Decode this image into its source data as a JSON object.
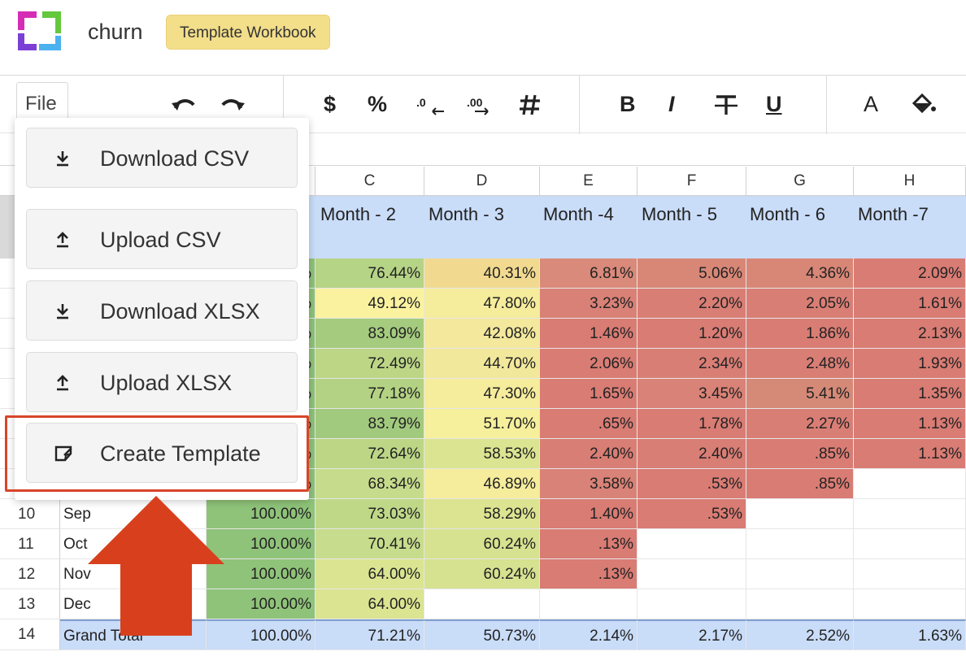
{
  "app": {
    "title": "churn",
    "badge": "Template Workbook"
  },
  "toolbar": {
    "file_label": "File",
    "currency": "$",
    "percent": "%",
    "bold": "B",
    "italic": "I",
    "underline": "U",
    "font_color": "A",
    "icons": [
      "undo-icon",
      "redo-icon",
      "currency-icon",
      "percent-icon",
      "decrease-decimal-icon",
      "increase-decimal-icon",
      "number-format-icon",
      "bold-icon",
      "italic-icon",
      "strikethrough-icon",
      "underline-icon",
      "font-color-icon",
      "fill-color-icon"
    ]
  },
  "menu": {
    "items": [
      {
        "label": "Download CSV",
        "icon": "download-icon"
      },
      {
        "label": "Upload CSV",
        "icon": "upload-icon"
      },
      {
        "label": "Download XLSX",
        "icon": "download-icon"
      },
      {
        "label": "Upload XLSX",
        "icon": "upload-icon"
      },
      {
        "label": "Create Template",
        "icon": "create-template-icon"
      }
    ],
    "highlight_color": "#d8452a"
  },
  "grid": {
    "columns": [
      "C",
      "D",
      "E",
      "F",
      "G",
      "H"
    ],
    "month_headers": [
      "Month - 2",
      "Month - 3",
      "Month -4",
      "Month - 5",
      "Month - 6",
      "Month -7"
    ],
    "partial_b_values": [
      "%",
      "%",
      "%",
      "%",
      "%",
      "%",
      "%",
      "%"
    ],
    "rows": [
      {
        "c": "76.44%",
        "d": "40.31%",
        "e": "6.81%",
        "f": "5.06%",
        "g": "4.36%",
        "h": "2.09%"
      },
      {
        "c": "49.12%",
        "d": "47.80%",
        "e": "3.23%",
        "f": "2.20%",
        "g": "2.05%",
        "h": "1.61%"
      },
      {
        "c": "83.09%",
        "d": "42.08%",
        "e": "1.46%",
        "f": "1.20%",
        "g": "1.86%",
        "h": "2.13%"
      },
      {
        "c": "72.49%",
        "d": "44.70%",
        "e": "2.06%",
        "f": "2.34%",
        "g": "2.48%",
        "h": "1.93%"
      },
      {
        "c": "77.18%",
        "d": "47.30%",
        "e": "1.65%",
        "f": "3.45%",
        "g": "5.41%",
        "h": "1.35%"
      },
      {
        "c": "83.79%",
        "d": "51.70%",
        "e": ".65%",
        "f": "1.78%",
        "g": "2.27%",
        "h": "1.13%"
      },
      {
        "c": "72.64%",
        "d": "58.53%",
        "e": "2.40%",
        "f": "2.40%",
        "g": ".85%",
        "h": "1.13%"
      },
      {
        "c": "68.34%",
        "d": "46.89%",
        "e": "3.58%",
        "f": ".53%",
        "g": ".85%",
        "h": ""
      }
    ],
    "lower_rows": [
      {
        "num": "10",
        "label": "Sep",
        "b": "100.00%",
        "c": "73.03%",
        "d": "58.29%",
        "e": "1.40%",
        "f": ".53%",
        "g": "",
        "h": ""
      },
      {
        "num": "11",
        "label": "Oct",
        "b": "100.00%",
        "c": "70.41%",
        "d": "60.24%",
        "e": ".13%",
        "f": "",
        "g": "",
        "h": ""
      },
      {
        "num": "12",
        "label": "Nov",
        "b": "100.00%",
        "c": "64.00%",
        "d": "60.24%",
        "e": ".13%",
        "f": "",
        "g": "",
        "h": ""
      },
      {
        "num": "13",
        "label": "Dec",
        "b": "100.00%",
        "c": "64.00%",
        "d": "",
        "e": "",
        "f": "",
        "g": "",
        "h": ""
      }
    ],
    "total_row": {
      "num": "14",
      "label": "Grand Total",
      "b": "100.00%",
      "c": "71.21%",
      "d": "50.73%",
      "e": "2.14%",
      "f": "2.17%",
      "g": "2.52%",
      "h": "1.63%"
    },
    "colors": {
      "header_blue": "#c9dcf8",
      "green": "#8fc379",
      "light_green": "#c6dc8c",
      "yellow": "#f6ef9c",
      "red": "#d97c74"
    }
  }
}
